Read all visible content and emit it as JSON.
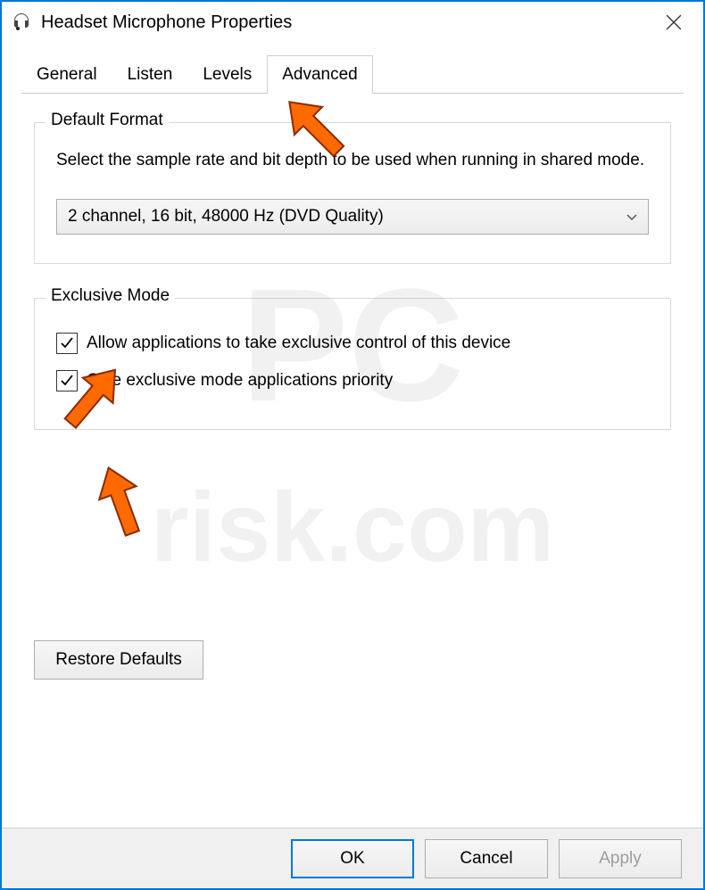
{
  "window": {
    "title": "Headset Microphone Properties",
    "icon": "headset-icon"
  },
  "tabs": [
    {
      "label": "General",
      "active": false
    },
    {
      "label": "Listen",
      "active": false
    },
    {
      "label": "Levels",
      "active": false
    },
    {
      "label": "Advanced",
      "active": true
    }
  ],
  "default_format": {
    "legend": "Default Format",
    "description": "Select the sample rate and bit depth to be used when running in shared mode.",
    "selected": "2 channel, 16 bit, 48000 Hz (DVD Quality)"
  },
  "exclusive_mode": {
    "legend": "Exclusive Mode",
    "options": [
      {
        "label": "Allow applications to take exclusive control of this device",
        "checked": true
      },
      {
        "label": "Give exclusive mode applications priority",
        "checked": true
      }
    ]
  },
  "restore_defaults_label": "Restore Defaults",
  "footer": {
    "ok": "OK",
    "cancel": "Cancel",
    "apply": "Apply"
  },
  "watermark_text": "PCrisk.com",
  "annotation_arrows": [
    {
      "target": "advanced-tab"
    },
    {
      "target": "checkbox-exclusive-control"
    },
    {
      "target": "checkbox-exclusive-priority"
    }
  ]
}
